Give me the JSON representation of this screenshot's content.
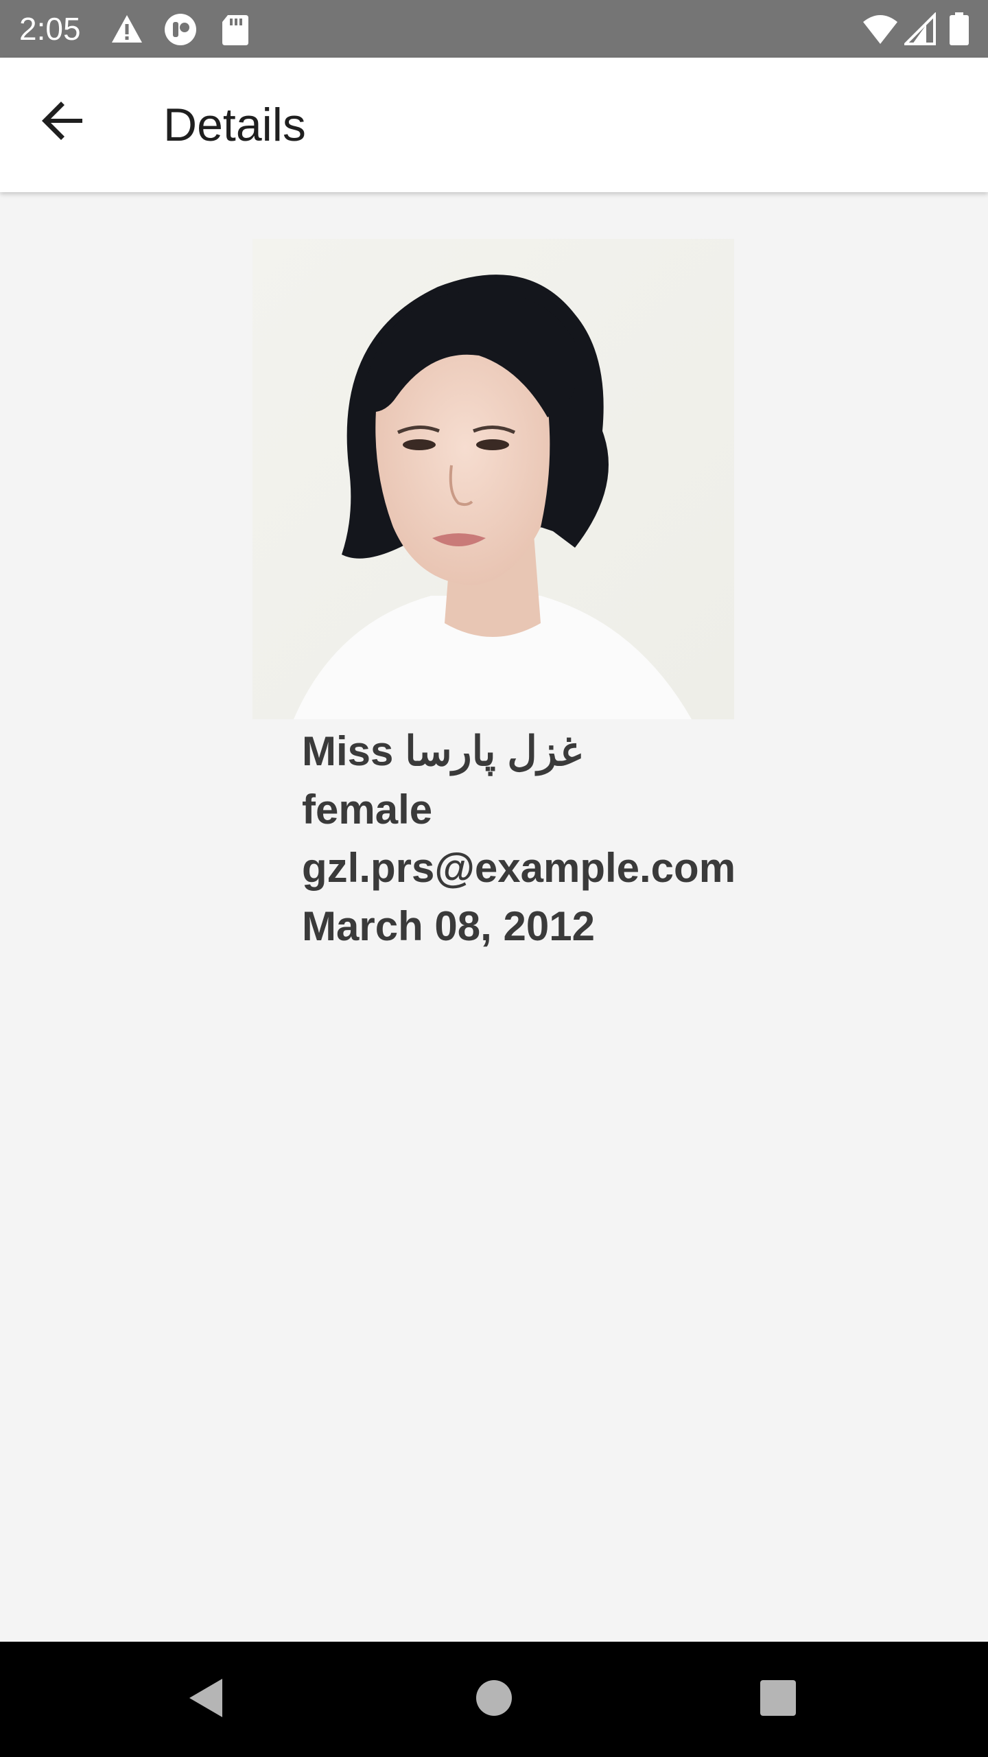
{
  "status_bar": {
    "time": "2:05",
    "left_icons": [
      "alert-triangle-icon",
      "record-icon",
      "sd-card-icon"
    ],
    "right_icons": [
      "wifi-icon",
      "cell-signal-icon",
      "battery-icon"
    ],
    "background": "#757575"
  },
  "app_bar": {
    "title": "Details",
    "back_icon": "arrow-back-icon"
  },
  "profile": {
    "photo_alt": "profile photo",
    "name": "Miss غزل پارسا",
    "gender": "female",
    "email": "gzl.prs@example.com",
    "dob": "March 08, 2012"
  },
  "nav_bar": {
    "buttons": [
      "back-triangle-icon",
      "home-circle-icon",
      "recents-square-icon"
    ]
  }
}
